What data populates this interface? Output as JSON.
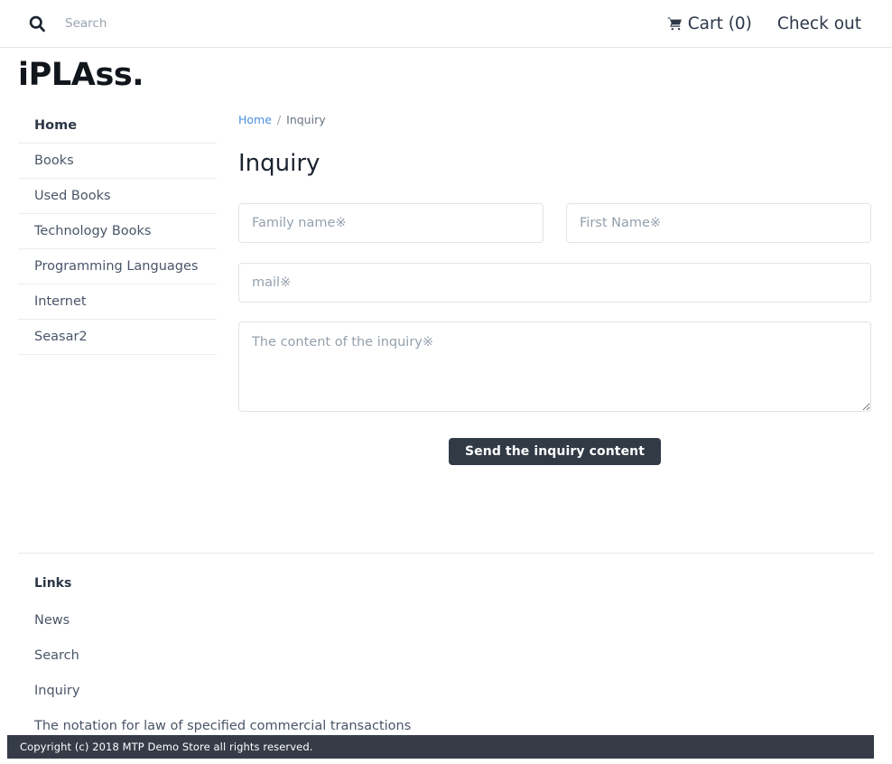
{
  "header": {
    "search": {
      "icon": "search-icon",
      "placeholder": "Search",
      "value": ""
    },
    "cart": {
      "icon": "shopping-cart-icon",
      "label": "Cart (0)",
      "count": 0
    },
    "checkout_label": "Check out"
  },
  "brand": {
    "logo_text": "iPLAss."
  },
  "sidebar": {
    "items": [
      {
        "label": "Home",
        "active": true
      },
      {
        "label": "Books",
        "active": false
      },
      {
        "label": "Used Books",
        "active": false
      },
      {
        "label": "Technology Books",
        "active": false
      },
      {
        "label": "Programming Languages",
        "active": false
      },
      {
        "label": "Internet",
        "active": false
      },
      {
        "label": "Seasar2",
        "active": false
      }
    ]
  },
  "main": {
    "breadcrumb": {
      "home_label": "Home",
      "separator": "/",
      "current_label": "Inquiry"
    },
    "title": "Inquiry",
    "form": {
      "family_name": {
        "placeholder": "Family name※",
        "value": ""
      },
      "first_name": {
        "placeholder": "First Name※",
        "value": ""
      },
      "mail": {
        "placeholder": "mail※",
        "value": ""
      },
      "content": {
        "placeholder": "The content of the inquiry※",
        "value": ""
      },
      "submit_label": "Send the inquiry content"
    }
  },
  "footer": {
    "title": "Links",
    "links": [
      {
        "label": "News"
      },
      {
        "label": "Search"
      },
      {
        "label": "Inquiry"
      },
      {
        "label": "The notation for law of specified commercial transactions"
      }
    ],
    "copyright": "Copyright (c) 2018 MTP Demo Store all rights reserved."
  },
  "colors": {
    "link_blue": "#4a90e2",
    "dark_bar": "#353c48",
    "button_dark": "#323a46",
    "text_primary": "#3c4858",
    "border": "#e0e4e8"
  }
}
